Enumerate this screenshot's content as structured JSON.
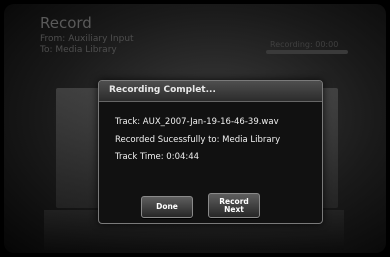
{
  "background": {
    "title": "Record",
    "from": "From: Auxiliary Input",
    "to": "To: Media Library",
    "status": "Recording: 00:00",
    "progress": 0
  },
  "dialog": {
    "title": "Recording Complet...",
    "track_line": "Track: AUX_2007-Jan-19-16-46-39.wav",
    "recorded_line": "Recorded Sucessfully to: Media Library",
    "time_line": "Track Time: 0:04:44",
    "done_label": "Done",
    "record_label": "Record",
    "next_label": "Next"
  }
}
